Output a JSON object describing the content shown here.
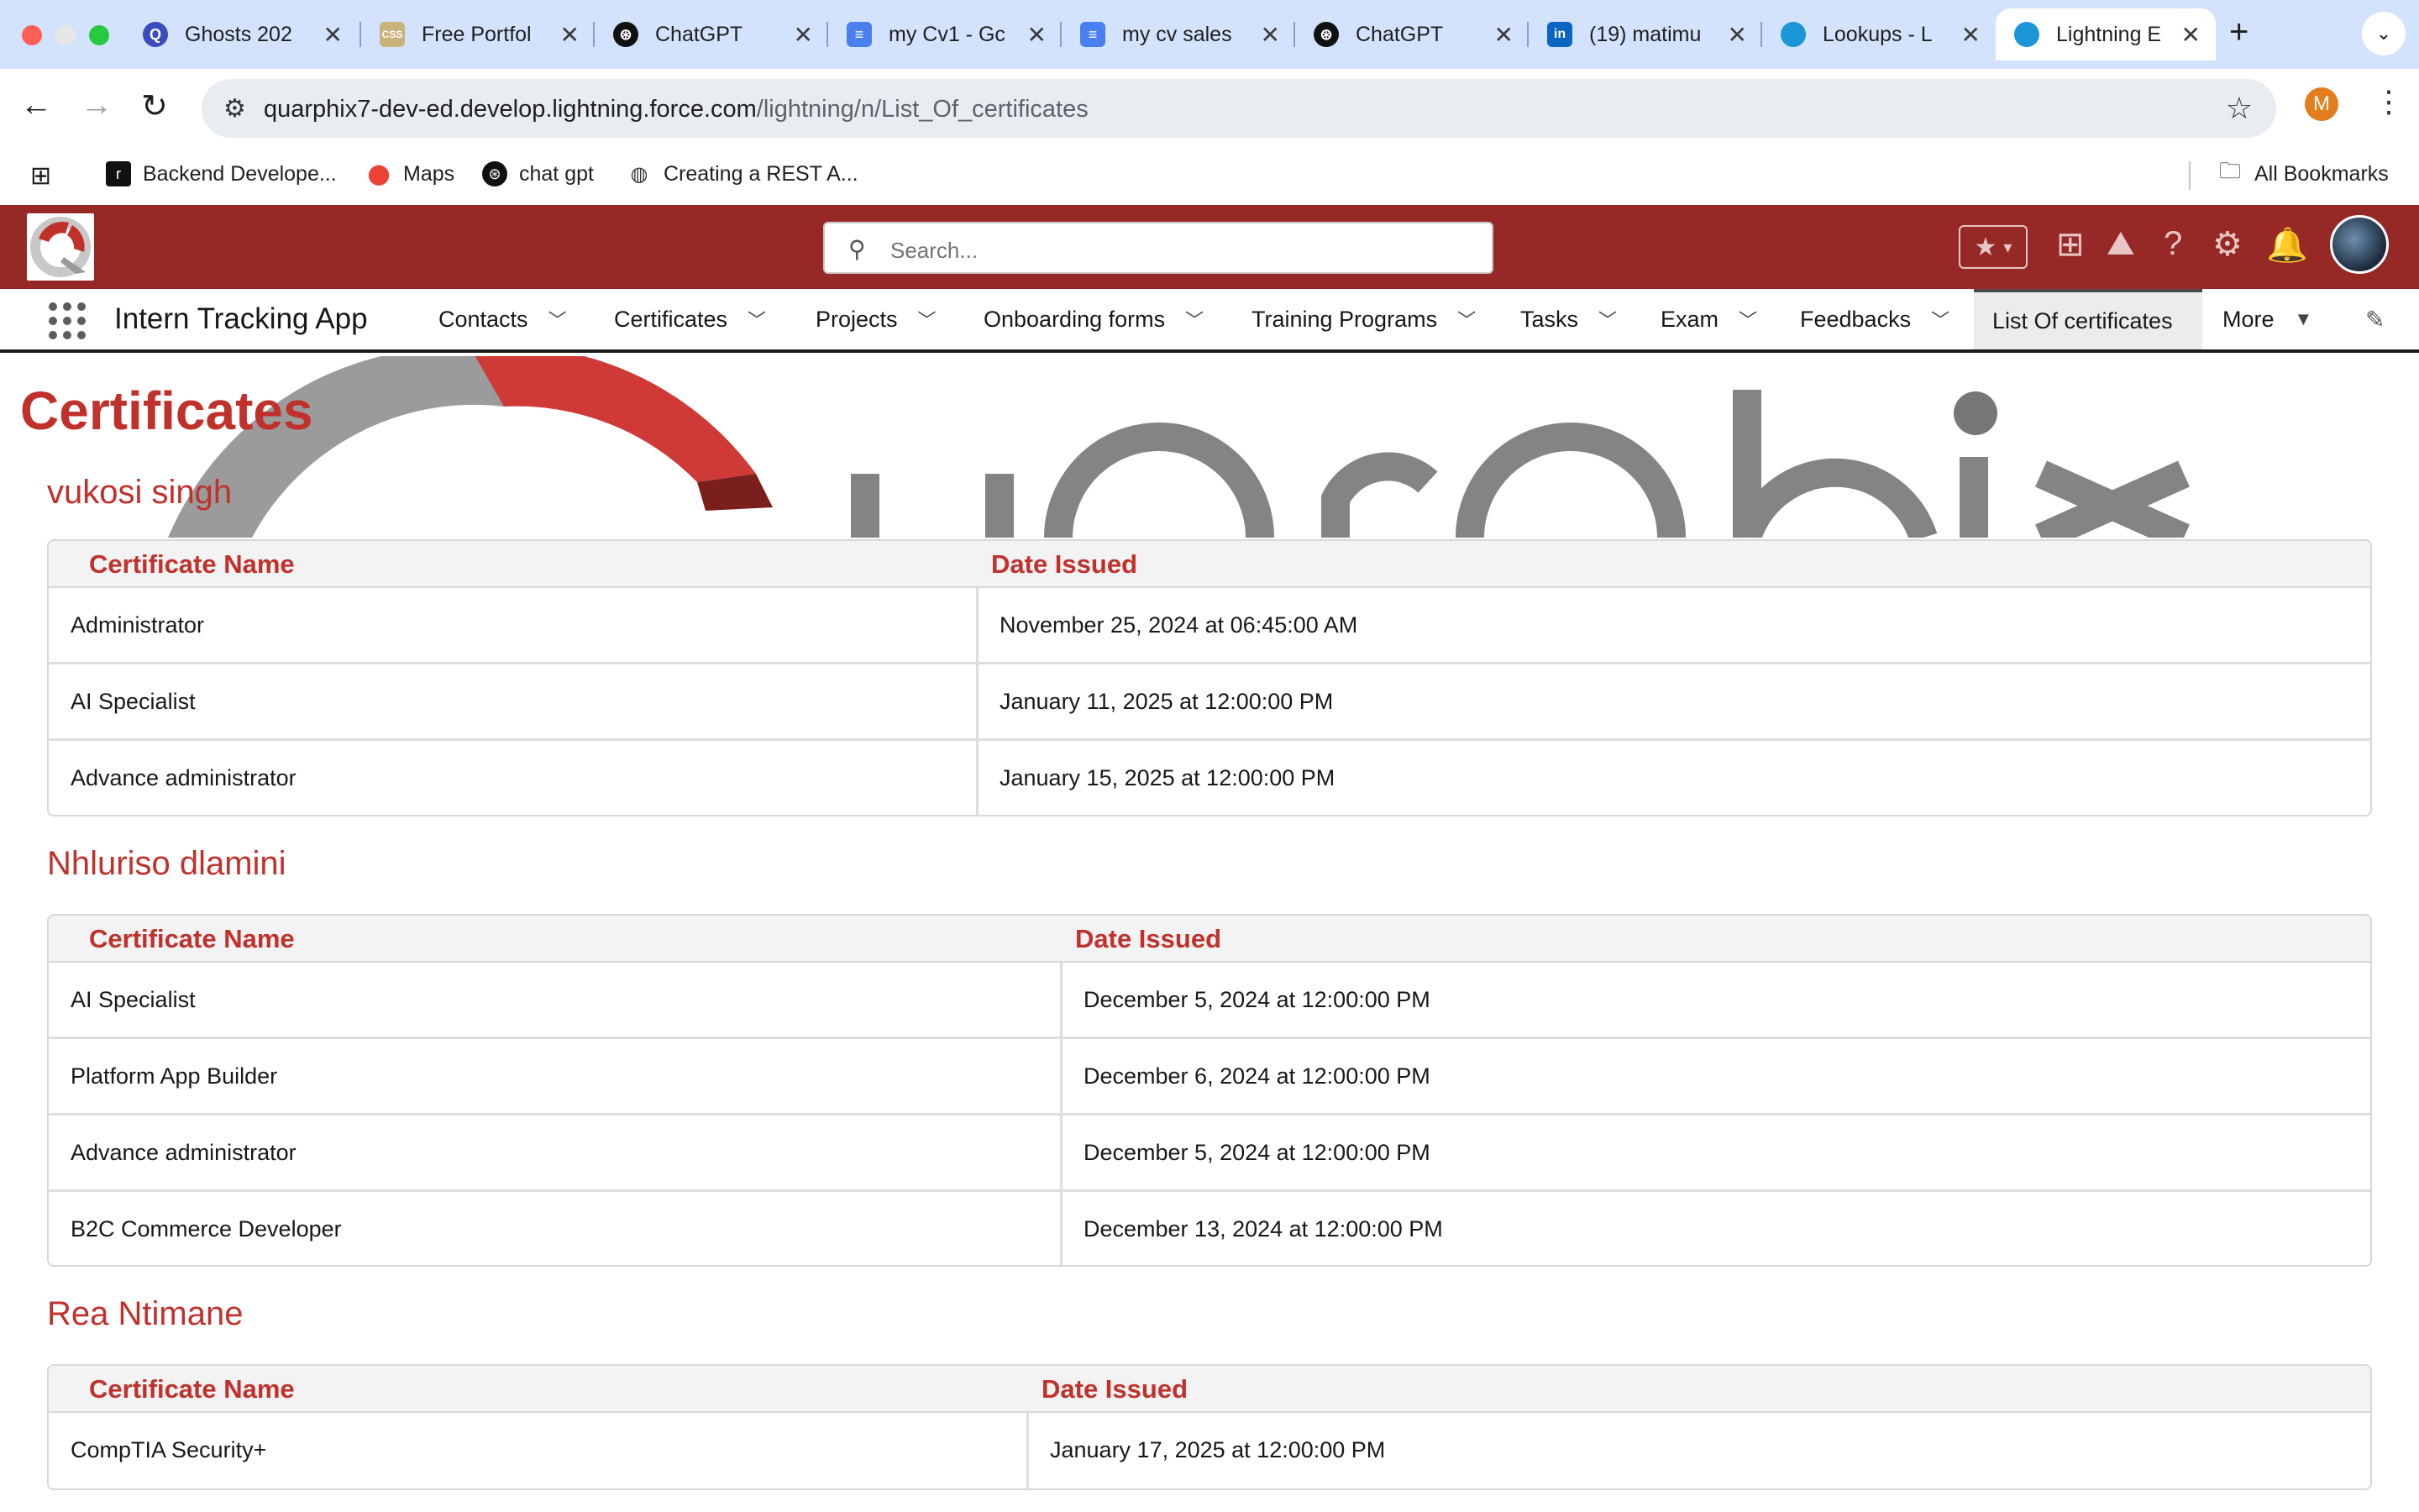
{
  "browser": {
    "tabs": [
      {
        "title": "Ghosts 202",
        "icon": "ghost-icon"
      },
      {
        "title": "Free Portfol",
        "icon": "css-icon"
      },
      {
        "title": "ChatGPT",
        "icon": "openai-icon"
      },
      {
        "title": "my Cv1 - Gc",
        "icon": "docs-icon"
      },
      {
        "title": "my cv sales",
        "icon": "docs-icon"
      },
      {
        "title": "ChatGPT",
        "icon": "openai-icon"
      },
      {
        "title": "(19) matimu",
        "icon": "linkedin-icon"
      },
      {
        "title": "Lookups - L",
        "icon": "salesforce-icon"
      },
      {
        "title": "Lightning E",
        "icon": "salesforce-icon"
      }
    ],
    "url_host": "quarphix7-dev-ed.develop.lightning.force.com",
    "url_path": "/lightning/n/List_Of_certificates",
    "profile_initial": "M",
    "bookmarks": [
      {
        "label": "Backend Develope...",
        "icon": "r-icon"
      },
      {
        "label": "Maps",
        "icon": "maps-pin-icon"
      },
      {
        "label": "chat gpt",
        "icon": "openai-icon"
      },
      {
        "label": "Creating a REST A...",
        "icon": "globe-icon"
      }
    ],
    "all_bookmarks": "All Bookmarks"
  },
  "sf": {
    "search_placeholder": "Search...",
    "app_name": "Intern Tracking App",
    "nav": [
      {
        "label": "Contacts",
        "chevron": true
      },
      {
        "label": "Certificates",
        "chevron": true
      },
      {
        "label": "Projects",
        "chevron": true
      },
      {
        "label": "Onboarding forms",
        "chevron": true
      },
      {
        "label": "Training Programs",
        "chevron": true
      },
      {
        "label": "Tasks",
        "chevron": true
      },
      {
        "label": "Exam",
        "chevron": true
      },
      {
        "label": "Feedbacks",
        "chevron": true
      },
      {
        "label": "List Of certificates",
        "chevron": false,
        "active": true
      },
      {
        "label": "More",
        "chevron": true
      }
    ]
  },
  "page": {
    "title": "Certificates",
    "col_name": "Certificate Name",
    "col_date": "Date Issued",
    "people": [
      {
        "name": "vukosi singh",
        "certs": [
          {
            "name": "Administrator",
            "date": "November 25, 2024 at 06:45:00 AM"
          },
          {
            "name": "AI Specialist",
            "date": "January 11, 2025 at 12:00:00 PM"
          },
          {
            "name": "Advance administrator",
            "date": "January 15, 2025 at 12:00:00 PM"
          }
        ]
      },
      {
        "name": "Nhluriso dlamini",
        "certs": [
          {
            "name": "AI Specialist",
            "date": "December 5, 2024 at 12:00:00 PM"
          },
          {
            "name": "Platform App Builder",
            "date": "December 6, 2024 at 12:00:00 PM"
          },
          {
            "name": "Advance administrator",
            "date": "December 5, 2024 at 12:00:00 PM"
          },
          {
            "name": "B2C Commerce Developer",
            "date": "December 13, 2024 at 12:00:00 PM"
          }
        ]
      },
      {
        "name": "Rea Ntimane",
        "certs": [
          {
            "name": "CompTIA Security+",
            "date": "January 17, 2025 at 12:00:00 PM"
          }
        ]
      }
    ]
  },
  "colors": {
    "header_bg": "#962825",
    "accent": "#c1312c",
    "tabstrip": "#d3e3fd"
  }
}
